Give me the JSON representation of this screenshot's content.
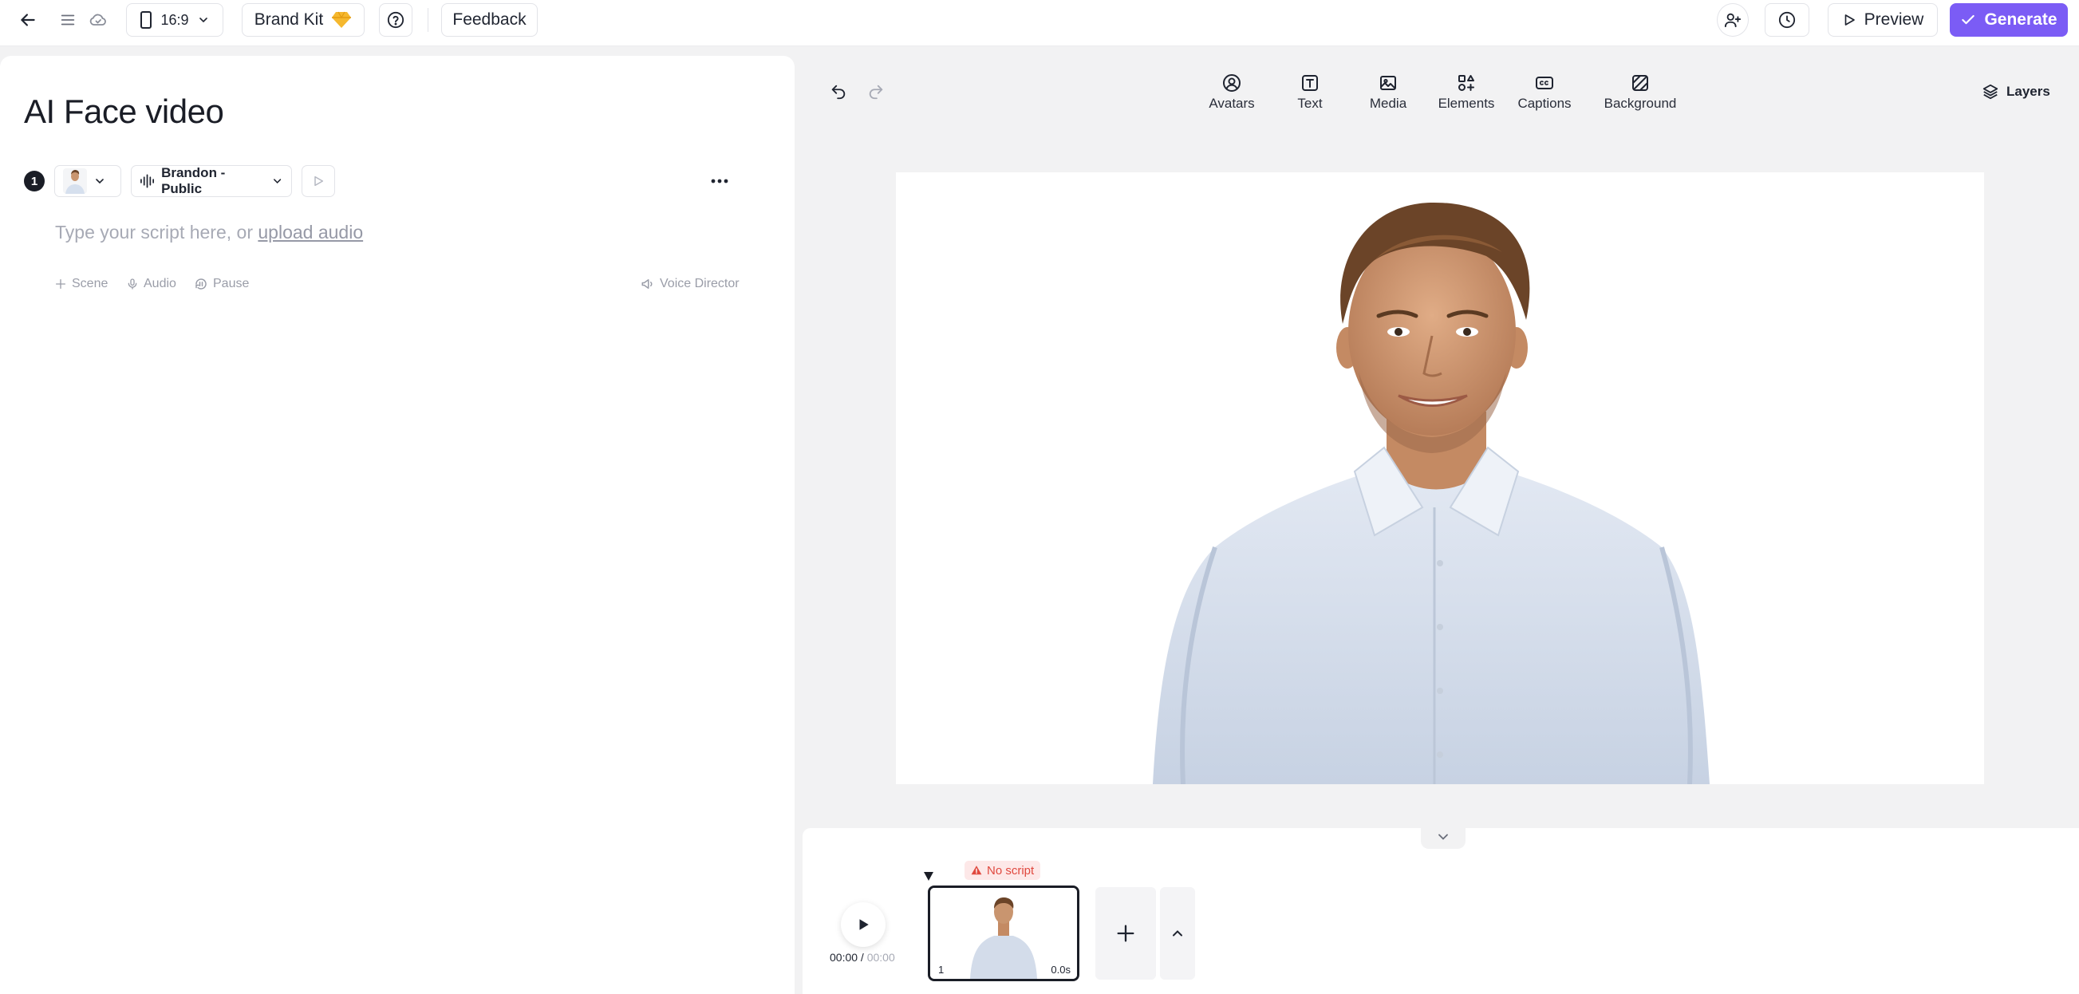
{
  "topbar": {
    "aspect_ratio": "16:9",
    "brand_kit_label": "Brand Kit",
    "feedback_label": "Feedback",
    "preview_label": "Preview",
    "generate_label": "Generate"
  },
  "editor": {
    "title": "AI Face video",
    "scene_number": "1",
    "voice_label": "Brandon - Public",
    "script_placeholder": "Type your script here, or",
    "upload_link": "upload audio",
    "tools": {
      "scene": "Scene",
      "audio": "Audio",
      "pause": "Pause",
      "voice_director": "Voice Director"
    }
  },
  "toolbar": {
    "avatars": "Avatars",
    "text": "Text",
    "media": "Media",
    "elements": "Elements",
    "captions": "Captions",
    "background": "Background",
    "layers": "Layers"
  },
  "timeline": {
    "current_time": "00:00",
    "separator": " / ",
    "total_time": "00:00",
    "clip_badge": "No script",
    "clip_index": "1",
    "clip_duration": "0.0s"
  },
  "colors": {
    "accent": "#7b5cf5",
    "warning": "#e0483e",
    "brand_kit_gem": "#f5b82e"
  },
  "icons": [
    "back-arrow-icon",
    "menu-icon",
    "cloud-icon",
    "phone-icon",
    "chevron-down-icon",
    "gem-icon",
    "help-icon",
    "add-user-icon",
    "history-icon",
    "play-outline-icon",
    "check-icon",
    "undo-icon",
    "redo-icon",
    "avatar-icon",
    "text-icon",
    "media-icon",
    "elements-icon",
    "captions-icon",
    "background-icon",
    "layers-icon",
    "waveform-icon",
    "more-icon",
    "plus-icon",
    "mic-icon",
    "pause-icon",
    "megaphone-icon",
    "play-icon",
    "warning-icon",
    "chevron-up-icon"
  ]
}
